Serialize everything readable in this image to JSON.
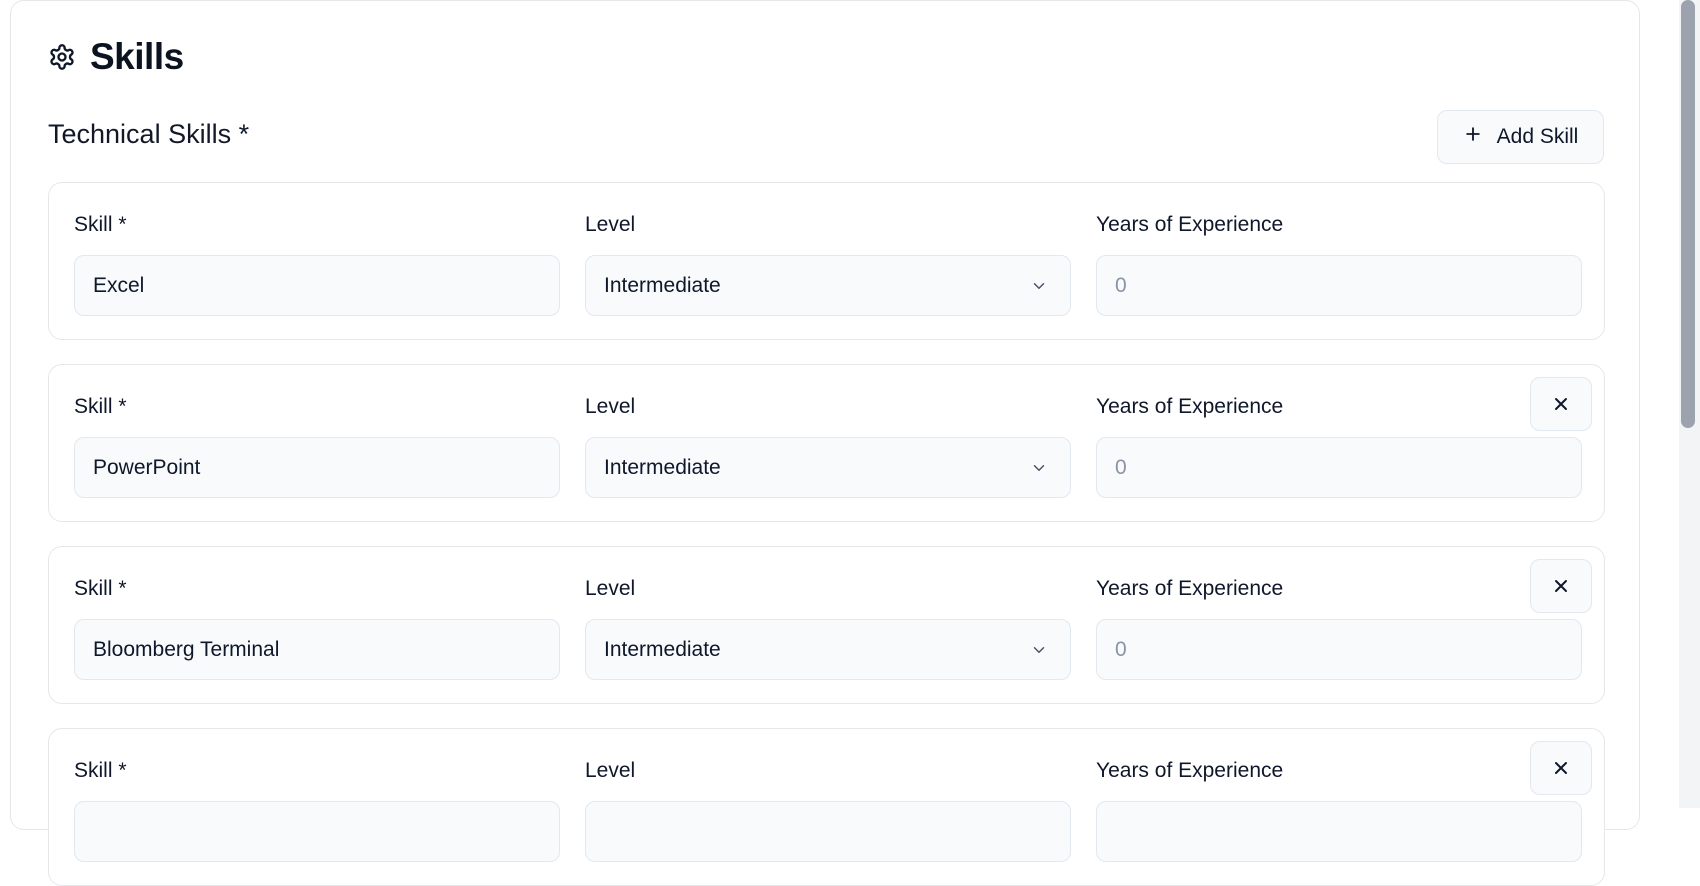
{
  "section": {
    "title": "Skills",
    "icon": "gear-icon"
  },
  "technical": {
    "title": "Technical Skills *",
    "add_label": "Add Skill"
  },
  "labels": {
    "skill": "Skill *",
    "level": "Level",
    "years": "Years of Experience"
  },
  "skills": [
    {
      "name": "Excel",
      "level": "Intermediate",
      "years_placeholder": "0",
      "removable": false
    },
    {
      "name": "PowerPoint",
      "level": "Intermediate",
      "years_placeholder": "0",
      "removable": true
    },
    {
      "name": "Bloomberg Terminal",
      "level": "Intermediate",
      "years_placeholder": "0",
      "removable": true
    },
    {
      "name": "",
      "level": "",
      "years_placeholder": "",
      "removable": true
    }
  ],
  "colors": {
    "text": "#0f172a",
    "border": "#e5e7eb",
    "input_bg": "#f8fafc",
    "placeholder": "#8a94a6"
  }
}
